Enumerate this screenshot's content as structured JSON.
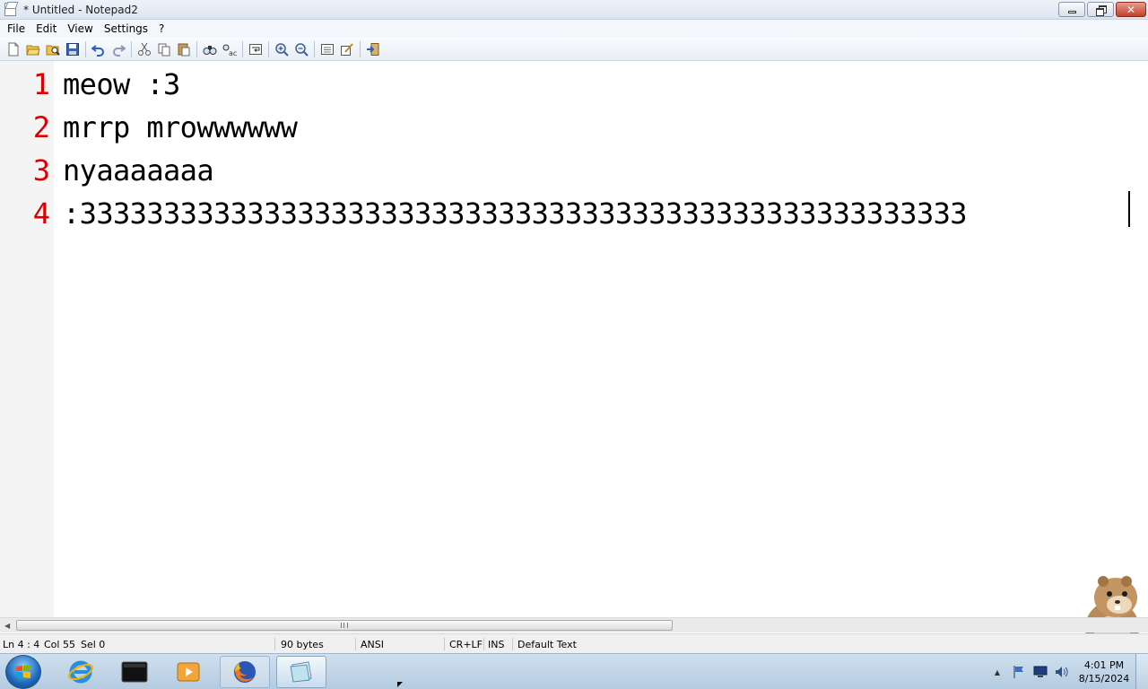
{
  "window": {
    "title": "* Untitled - Notepad2"
  },
  "menu": {
    "items": [
      "File",
      "Edit",
      "View",
      "Settings",
      "?"
    ]
  },
  "toolbar": {
    "buttons": [
      "new-icon",
      "open-icon",
      "browse-icon",
      "save-icon",
      "undo-icon",
      "redo-icon",
      "cut-icon",
      "copy-icon",
      "paste-icon",
      "find-icon",
      "replace-icon",
      "word-wrap-icon",
      "zoom-in-icon",
      "zoom-out-icon",
      "scheme-icon",
      "customize-icon",
      "exit-icon"
    ]
  },
  "editor": {
    "lines": [
      {
        "number": "1",
        "text": "meow :3"
      },
      {
        "number": "2",
        "text": "mrrp mrowwwwww"
      },
      {
        "number": "3",
        "text": "nyaaaaaaa"
      },
      {
        "number": "4",
        "text": ":33333333333333333333333333333333333333333333333333333"
      }
    ],
    "line_number_color": "#dd0000"
  },
  "statusbar": {
    "position": "Ln 4 : 4",
    "column": "Col 55",
    "selection": "Sel 0",
    "size": "90 bytes",
    "encoding": "ANSI",
    "line_endings": "CR+LF",
    "insert_mode": "INS",
    "scheme": "Default Text"
  },
  "taskbar": {
    "apps": [
      "ie-icon",
      "terminal-icon",
      "media-player-icon",
      "firefox-icon",
      "notepad2-icon"
    ],
    "clock_time": "4:01 PM",
    "clock_date": "8/15/2024"
  }
}
